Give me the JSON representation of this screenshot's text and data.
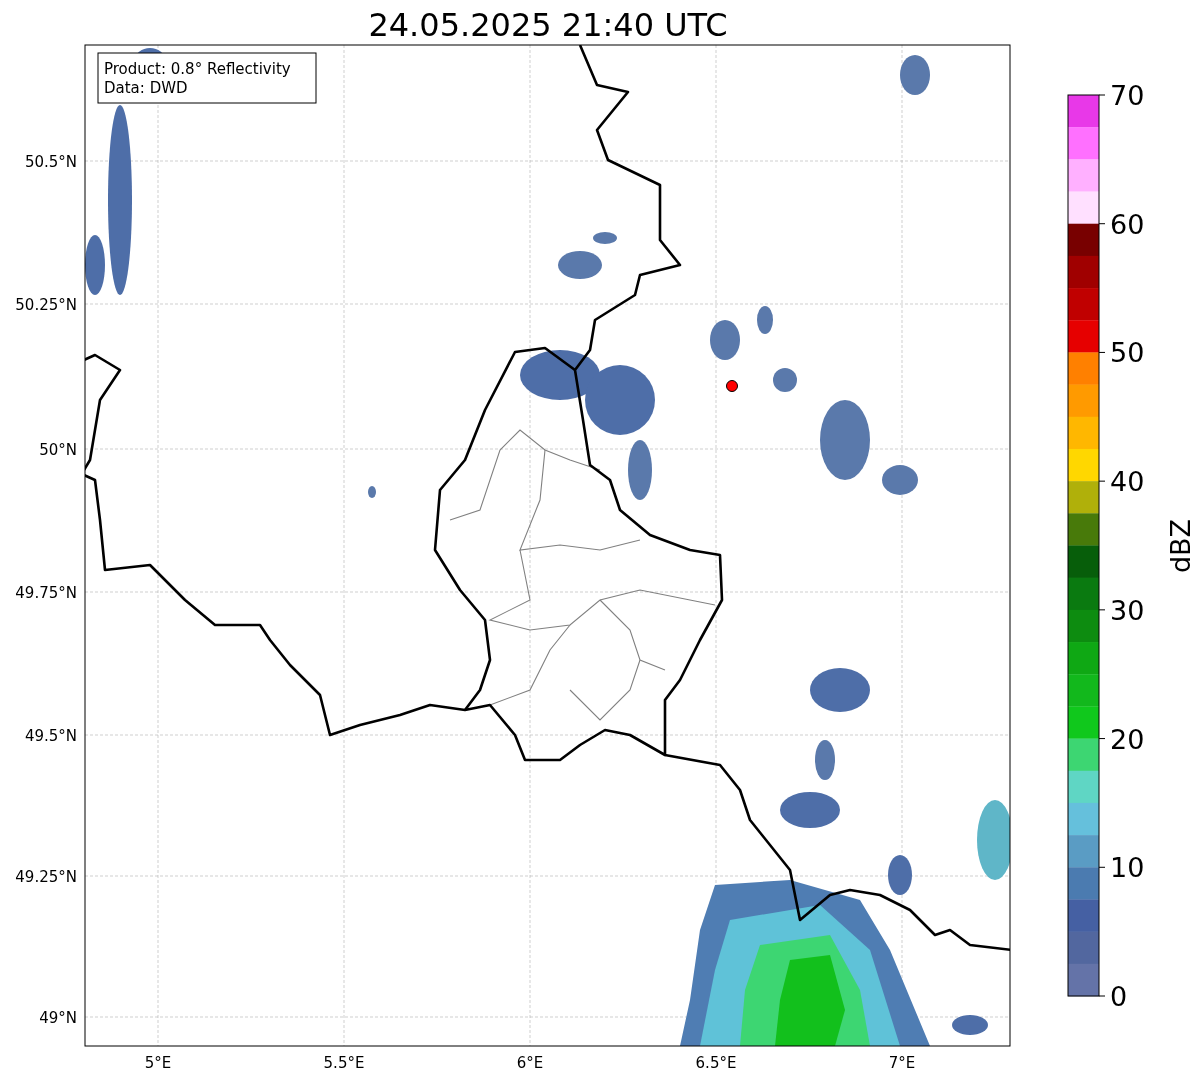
{
  "title": "24.05.2025 21:40 UTC",
  "legend": [
    "Product: 0.8° Reflectivity",
    "Data: DWD"
  ],
  "y_ticks": [
    "50.5°N",
    "50.25°N",
    "50°N",
    "49.75°N",
    "49.5°N",
    "49.25°N",
    "49°N"
  ],
  "x_ticks": [
    "5°E",
    "5.5°E",
    "6°E",
    "6.5°E",
    "7°E"
  ],
  "colorbar": {
    "label": "dBZ",
    "ticks": [
      "70",
      "60",
      "50",
      "40",
      "30",
      "20",
      "10",
      "0"
    ],
    "bands": [
      {
        "color": "#e838e8"
      },
      {
        "color": "#ff70ff"
      },
      {
        "color": "#ffb0ff"
      },
      {
        "color": "#ffe0ff"
      },
      {
        "color": "#780000"
      },
      {
        "color": "#a00000"
      },
      {
        "color": "#c00000"
      },
      {
        "color": "#e60000"
      },
      {
        "color": "#ff8000"
      },
      {
        "color": "#ff9a00"
      },
      {
        "color": "#ffb700"
      },
      {
        "color": "#ffd700"
      },
      {
        "color": "#b0b00a"
      },
      {
        "color": "#487a0a"
      },
      {
        "color": "#075e0a"
      },
      {
        "color": "#0a7a10"
      },
      {
        "color": "#0d8c10"
      },
      {
        "color": "#0fa814"
      },
      {
        "color": "#12b81c"
      },
      {
        "color": "#10c81c"
      },
      {
        "color": "#3dd672"
      },
      {
        "color": "#5fd6c4"
      },
      {
        "color": "#65c0dc"
      },
      {
        "color": "#5a9cc4"
      },
      {
        "color": "#4b7bb0"
      },
      {
        "color": "#4560a3"
      },
      {
        "color": "#52679f"
      },
      {
        "color": "#6473a8"
      }
    ]
  }
}
